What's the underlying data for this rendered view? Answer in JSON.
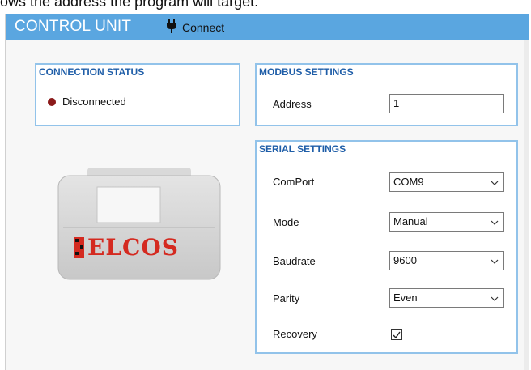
{
  "doc_text": "ows the address the program will target.",
  "window": {
    "title": "CONTROL UNIT",
    "connect_label": "Connect"
  },
  "connection_status": {
    "title": "CONNECTION STATUS",
    "status": "Disconnected",
    "status_color": "#8b1a1a"
  },
  "modbus": {
    "title": "MODBUS SETTINGS",
    "address_label": "Address",
    "address_value": "1"
  },
  "serial": {
    "title": "SERIAL SETTINGS",
    "comport_label": "ComPort",
    "comport_value": "COM9",
    "mode_label": "Mode",
    "mode_value": "Manual",
    "baudrate_label": "Baudrate",
    "baudrate_value": "9600",
    "parity_label": "Parity",
    "parity_value": "Even",
    "recovery_label": "Recovery",
    "recovery_checked": true
  },
  "device": {
    "brand": "ELCOS"
  },
  "colors": {
    "titlebar": "#5aa6e0",
    "group_border": "#92c3ea",
    "group_title": "#1f5ea8",
    "brand_red": "#d42a20"
  }
}
